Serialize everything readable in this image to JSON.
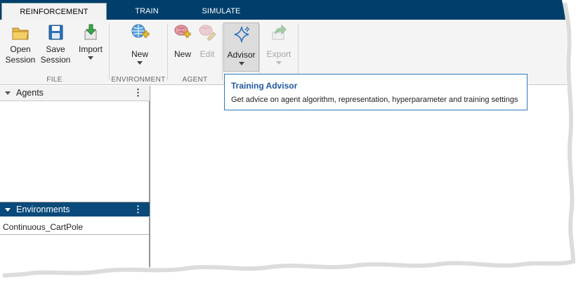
{
  "tabs": [
    {
      "label": "REINFORCEMENT LEARNING",
      "active": true
    },
    {
      "label": "TRAIN",
      "active": false
    },
    {
      "label": "SIMULATE",
      "active": false
    }
  ],
  "ribbon": {
    "file": {
      "group_label": "FILE",
      "open_line1": "Open",
      "open_line2": "Session",
      "save_line1": "Save",
      "save_line2": "Session",
      "import_label": "Import"
    },
    "environment": {
      "group_label": "ENVIRONMENT",
      "new_label": "New"
    },
    "agent": {
      "group_label": "AGENT",
      "new_label": "New",
      "edit_label": "Edit",
      "advisor_label": "Advisor",
      "export_label": "Export"
    }
  },
  "tooltip": {
    "title": "Training Advisor",
    "description": "Get advice on agent algorithm, representation, hyperparameter and training settings"
  },
  "panels": {
    "agents": {
      "title": "Agents",
      "items": []
    },
    "environments": {
      "title": "Environments",
      "items": [
        "Continuous_CartPole"
      ]
    }
  },
  "colors": {
    "tabstrip": "#003e6b",
    "ribbon": "#f4f4f4",
    "accent": "#1f5aa0",
    "env_header": "#0a4a7a"
  }
}
